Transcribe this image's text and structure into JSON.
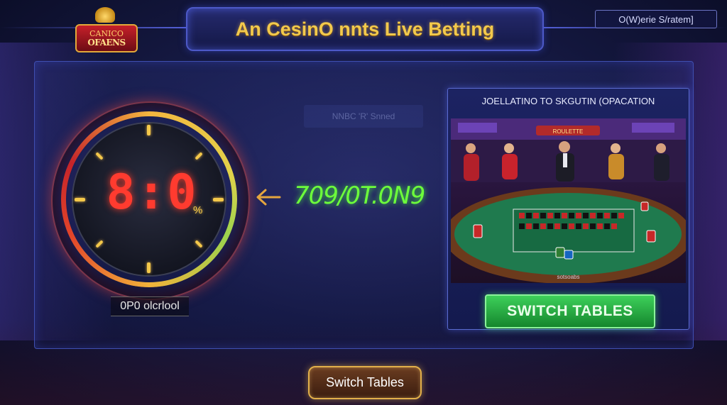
{
  "header": {
    "title": "An CesinO nnts Live Betting",
    "logo_line1": "CANICO",
    "logo_line2": "OFAENS",
    "system_label": "O(W)erie S/ratem]"
  },
  "background": {
    "sign_text": "NNBC 'R' Snned"
  },
  "timer": {
    "display": "8:0",
    "unit": "%",
    "label": "0P0 olcrlool"
  },
  "odds": {
    "text": "709/0T.0N9"
  },
  "table_card": {
    "title": "JOELLATINO TO SKGUTIN (OPACATION",
    "caption": "sotsoabs",
    "button_label": "SWITCH TABLES",
    "sign_text": "ROULETTE"
  },
  "footer": {
    "button_label": "Switch Tables"
  },
  "colors": {
    "accent_gold": "#f2c94c",
    "timer_red": "#ff3b2f",
    "odds_green": "#6dff3b",
    "button_green": "#3dd05a",
    "panel_blue": "#3f4fb0"
  }
}
